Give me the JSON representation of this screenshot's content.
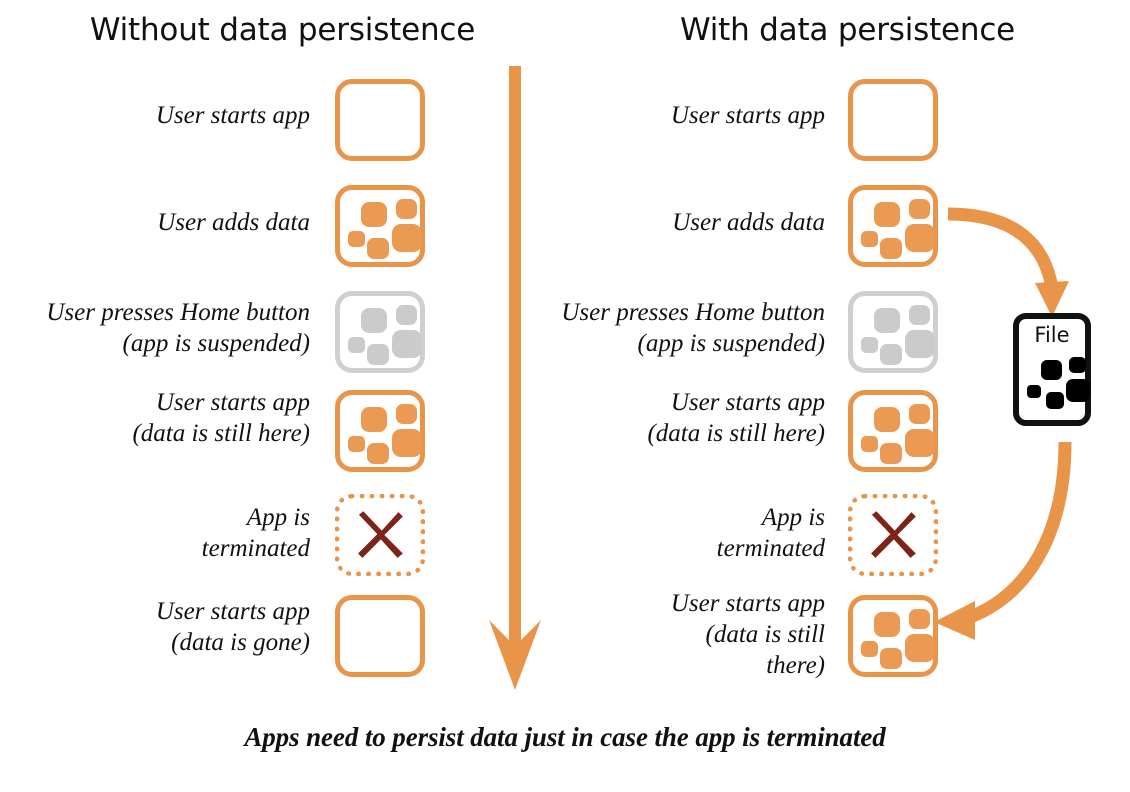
{
  "headings": {
    "left": "Without data persistence",
    "right": "With data persistence"
  },
  "caption": "Apps need to persist data just in case the app is terminated",
  "file": {
    "label": "File"
  },
  "colors": {
    "orange": "#e8954a",
    "orange_fill": "#eb9a53",
    "gray": "#cfcfcf",
    "gray_fill": "#cbcbcb",
    "x_mark": "#7d2318",
    "black": "#111111",
    "background": "#ffffff"
  },
  "left_column": {
    "steps": [
      {
        "lines": [
          "User starts app"
        ],
        "state": "empty"
      },
      {
        "lines": [
          "User adds data"
        ],
        "state": "data"
      },
      {
        "lines": [
          "User presses Home button",
          "(app is suspended)"
        ],
        "state": "suspended"
      },
      {
        "lines": [
          "User starts app",
          "(data is still here)"
        ],
        "state": "data"
      },
      {
        "lines": [
          "App is",
          "terminated"
        ],
        "state": "terminated"
      },
      {
        "lines": [
          "User starts app",
          "(data is gone)"
        ],
        "state": "empty"
      }
    ]
  },
  "right_column": {
    "steps": [
      {
        "lines": [
          "User starts app"
        ],
        "state": "empty"
      },
      {
        "lines": [
          "User adds data"
        ],
        "state": "data"
      },
      {
        "lines": [
          "User presses Home button",
          "(app is suspended)"
        ],
        "state": "suspended"
      },
      {
        "lines": [
          "User starts app",
          "(data is still here)"
        ],
        "state": "data"
      },
      {
        "lines": [
          "App is",
          "terminated"
        ],
        "state": "terminated"
      },
      {
        "lines": [
          "User starts app",
          "(data is still",
          "there)"
        ],
        "state": "data"
      }
    ]
  },
  "arrows": {
    "timeline": "downward-timeline-arrow",
    "save_to_file": "app-saves-data-to-file",
    "restore_from_file": "file-restores-data-to-app"
  }
}
